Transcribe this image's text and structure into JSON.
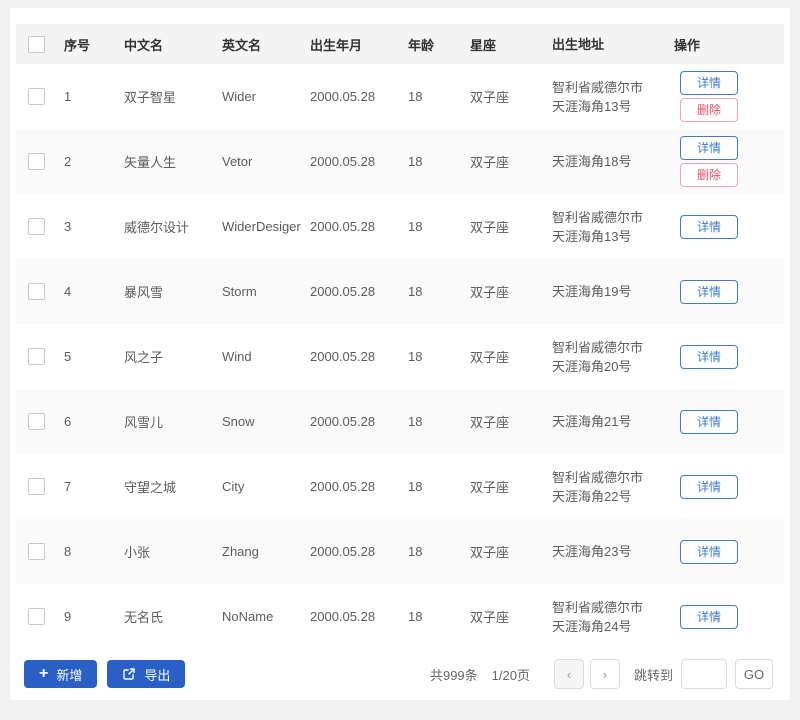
{
  "colors": {
    "page_bg": "#f1f1f1",
    "card_bg": "#ffffff",
    "header_row_bg": "#f4f4f5",
    "alt_row_bg": "#fafafa",
    "primary_button_bg": "#2a5fc5",
    "detail_button_color": "#3b7bd2",
    "delete_button_color": "#ef5064",
    "body_text": "#5c5c5c",
    "header_text": "#333333"
  },
  "table": {
    "columns": [
      "序号",
      "中文名",
      "英文名",
      "出生年月",
      "年龄",
      "星座",
      "出生地址",
      "操作"
    ],
    "rows": [
      {
        "index": "1",
        "cn": "双子智星",
        "en": "Wider",
        "birth": "2000.05.28",
        "age": "18",
        "zodiac": "双子座",
        "addr1": "智利省威德尔市",
        "addr2": "天涯海角13号",
        "actions": [
          {
            "type": "detail",
            "label": "详情"
          },
          {
            "type": "delete",
            "label": "删除"
          }
        ]
      },
      {
        "index": "2",
        "cn": "矢量人生",
        "en": "Vetor",
        "birth": "2000.05.28",
        "age": "18",
        "zodiac": "双子座",
        "addr1": "天涯海角18号",
        "addr2": "",
        "actions": [
          {
            "type": "detail",
            "label": "详情"
          },
          {
            "type": "delete",
            "label": "删除"
          }
        ]
      },
      {
        "index": "3",
        "cn": "威德尔设计",
        "en": "WiderDesiger",
        "birth": "2000.05.28",
        "age": "18",
        "zodiac": "双子座",
        "addr1": "智利省威德尔市",
        "addr2": "天涯海角13号",
        "actions": [
          {
            "type": "detail",
            "label": "详情"
          }
        ]
      },
      {
        "index": "4",
        "cn": "暴风雪",
        "en": "Storm",
        "birth": "2000.05.28",
        "age": "18",
        "zodiac": "双子座",
        "addr1": "天涯海角19号",
        "addr2": "",
        "actions": [
          {
            "type": "detail",
            "label": "详情"
          }
        ]
      },
      {
        "index": "5",
        "cn": "风之子",
        "en": "Wind",
        "birth": "2000.05.28",
        "age": "18",
        "zodiac": "双子座",
        "addr1": "智利省威德尔市",
        "addr2": "天涯海角20号",
        "actions": [
          {
            "type": "detail",
            "label": "详情"
          }
        ]
      },
      {
        "index": "6",
        "cn": "风雪儿",
        "en": "Snow",
        "birth": "2000.05.28",
        "age": "18",
        "zodiac": "双子座",
        "addr1": "天涯海角21号",
        "addr2": "",
        "actions": [
          {
            "type": "detail",
            "label": "详情"
          }
        ]
      },
      {
        "index": "7",
        "cn": "守望之城",
        "en": "City",
        "birth": "2000.05.28",
        "age": "18",
        "zodiac": "双子座",
        "addr1": "智利省威德尔市",
        "addr2": "天涯海角22号",
        "actions": [
          {
            "type": "detail",
            "label": "详情"
          }
        ]
      },
      {
        "index": "8",
        "cn": "小张",
        "en": "Zhang",
        "birth": "2000.05.28",
        "age": "18",
        "zodiac": "双子座",
        "addr1": "天涯海角23号",
        "addr2": "",
        "actions": [
          {
            "type": "detail",
            "label": "详情"
          }
        ]
      },
      {
        "index": "9",
        "cn": "无名氏",
        "en": "NoName",
        "birth": "2000.05.28",
        "age": "18",
        "zodiac": "双子座",
        "addr1": "智利省威德尔市",
        "addr2": "天涯海角24号",
        "actions": [
          {
            "type": "detail",
            "label": "详情"
          }
        ]
      }
    ]
  },
  "toolbar": {
    "add_icon": "+",
    "add_label": "新增",
    "export_label": "导出"
  },
  "pagination": {
    "total": "共999条",
    "page": "1/20页",
    "prev": "‹",
    "next": "›",
    "jump_label": "跳转到",
    "jump_value": "",
    "go_label": "GO"
  }
}
